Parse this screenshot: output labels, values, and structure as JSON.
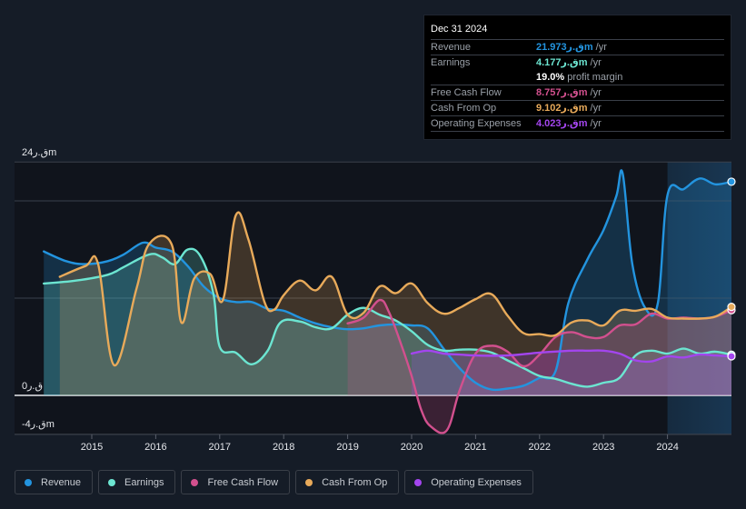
{
  "tooltip": {
    "date": "Dec 31 2024",
    "rows": [
      {
        "label": "Revenue",
        "value": "21.973ق.رm",
        "unit": "/yr",
        "color": "#2394df"
      },
      {
        "label": "Earnings",
        "value": "4.177ق.رm",
        "unit": "/yr",
        "color": "#6ce5d1"
      },
      {
        "label": "",
        "value": "19.0%",
        "unit": "profit margin",
        "color": "#ffffff"
      },
      {
        "label": "Free Cash Flow",
        "value": "8.757ق.رm",
        "unit": "/yr",
        "color": "#d2508e"
      },
      {
        "label": "Cash From Op",
        "value": "9.102ق.رm",
        "unit": "/yr",
        "color": "#e8aa5a"
      },
      {
        "label": "Operating Expenses",
        "value": "4.023ق.رm",
        "unit": "/yr",
        "color": "#a345ee"
      }
    ]
  },
  "legend": [
    {
      "label": "Revenue",
      "color": "#2394df"
    },
    {
      "label": "Earnings",
      "color": "#6ce5d1"
    },
    {
      "label": "Free Cash Flow",
      "color": "#d2508e"
    },
    {
      "label": "Cash From Op",
      "color": "#e8aa5a"
    },
    {
      "label": "Operating Expenses",
      "color": "#a345ee"
    }
  ],
  "chart_data": {
    "type": "area",
    "title": "",
    "xlabel": "",
    "ylabel": "",
    "y_unit": "ق.رm",
    "ylim": [
      -4,
      24
    ],
    "xlim": [
      2014.25,
      2025.0
    ],
    "y_tick_labels": [
      {
        "value": 24,
        "label": "24ق.رm"
      },
      {
        "value": 0,
        "label": "0ق.ر"
      },
      {
        "value": -4,
        "label": "-4ق.رm"
      }
    ],
    "gridlines": [
      24,
      20,
      10,
      0,
      -4
    ],
    "x_ticks": [
      "2015",
      "2016",
      "2017",
      "2018",
      "2019",
      "2020",
      "2021",
      "2022",
      "2023",
      "2024"
    ],
    "forecast_shade_from": 2024.0,
    "series": [
      {
        "name": "Revenue",
        "color": "#2394df",
        "points": [
          [
            2014.25,
            14.8
          ],
          [
            2014.6,
            13.8
          ],
          [
            2014.9,
            13.5
          ],
          [
            2015.25,
            13.8
          ],
          [
            2015.5,
            14.5
          ],
          [
            2015.8,
            15.7
          ],
          [
            2016.0,
            15.2
          ],
          [
            2016.25,
            14.8
          ],
          [
            2016.5,
            13.3
          ],
          [
            2016.75,
            11.2
          ],
          [
            2017.0,
            10.0
          ],
          [
            2017.25,
            9.6
          ],
          [
            2017.5,
            9.6
          ],
          [
            2017.75,
            8.9
          ],
          [
            2018.0,
            8.7
          ],
          [
            2018.25,
            8.0
          ],
          [
            2018.5,
            7.4
          ],
          [
            2018.75,
            7.0
          ],
          [
            2019.0,
            6.8
          ],
          [
            2019.25,
            6.9
          ],
          [
            2019.5,
            7.2
          ],
          [
            2019.75,
            7.3
          ],
          [
            2020.0,
            7.2
          ],
          [
            2020.25,
            6.9
          ],
          [
            2020.5,
            4.8
          ],
          [
            2020.75,
            2.8
          ],
          [
            2021.0,
            1.3
          ],
          [
            2021.25,
            0.6
          ],
          [
            2021.5,
            0.7
          ],
          [
            2021.75,
            1.0
          ],
          [
            2022.0,
            1.8
          ],
          [
            2022.25,
            2.5
          ],
          [
            2022.45,
            9.5
          ],
          [
            2022.75,
            14.0
          ],
          [
            2023.0,
            17.0
          ],
          [
            2023.2,
            20.5
          ],
          [
            2023.3,
            22.8
          ],
          [
            2023.45,
            13.5
          ],
          [
            2023.65,
            9.0
          ],
          [
            2023.85,
            9.5
          ],
          [
            2024.0,
            20.6
          ],
          [
            2024.25,
            21.2
          ],
          [
            2024.5,
            22.3
          ],
          [
            2024.75,
            21.7
          ],
          [
            2025.0,
            21.97
          ]
        ]
      },
      {
        "name": "Earnings",
        "color": "#6ce5d1",
        "points": [
          [
            2014.25,
            11.5
          ],
          [
            2014.75,
            11.8
          ],
          [
            2015.25,
            12.4
          ],
          [
            2015.5,
            13.2
          ],
          [
            2015.9,
            14.5
          ],
          [
            2016.1,
            14.2
          ],
          [
            2016.3,
            13.5
          ],
          [
            2016.5,
            15.0
          ],
          [
            2016.7,
            14.3
          ],
          [
            2016.9,
            10.5
          ],
          [
            2017.0,
            5.0
          ],
          [
            2017.25,
            4.4
          ],
          [
            2017.5,
            3.2
          ],
          [
            2017.75,
            4.6
          ],
          [
            2017.95,
            7.5
          ],
          [
            2018.25,
            7.6
          ],
          [
            2018.5,
            7.0
          ],
          [
            2018.75,
            6.9
          ],
          [
            2019.0,
            8.3
          ],
          [
            2019.25,
            9.0
          ],
          [
            2019.5,
            8.3
          ],
          [
            2019.75,
            7.7
          ],
          [
            2020.0,
            6.6
          ],
          [
            2020.25,
            5.2
          ],
          [
            2020.5,
            4.6
          ],
          [
            2020.75,
            4.7
          ],
          [
            2021.0,
            4.7
          ],
          [
            2021.25,
            4.4
          ],
          [
            2021.5,
            3.6
          ],
          [
            2021.75,
            2.8
          ],
          [
            2022.0,
            2.0
          ],
          [
            2022.25,
            1.7
          ],
          [
            2022.5,
            1.2
          ],
          [
            2022.75,
            0.9
          ],
          [
            2023.0,
            1.3
          ],
          [
            2023.25,
            1.8
          ],
          [
            2023.5,
            4.1
          ],
          [
            2023.75,
            4.6
          ],
          [
            2024.0,
            4.3
          ],
          [
            2024.25,
            4.8
          ],
          [
            2024.5,
            4.3
          ],
          [
            2024.75,
            4.5
          ],
          [
            2025.0,
            4.18
          ]
        ]
      },
      {
        "name": "Free Cash Flow",
        "color": "#d2508e",
        "points": [
          [
            2019.0,
            7.4
          ],
          [
            2019.25,
            8.0
          ],
          [
            2019.5,
            9.8
          ],
          [
            2019.65,
            8.5
          ],
          [
            2019.85,
            5.0
          ],
          [
            2020.0,
            2.0
          ],
          [
            2020.15,
            -1.5
          ],
          [
            2020.3,
            -3.2
          ],
          [
            2020.55,
            -3.6
          ],
          [
            2020.75,
            0.5
          ],
          [
            2021.0,
            4.3
          ],
          [
            2021.25,
            5.1
          ],
          [
            2021.5,
            4.5
          ],
          [
            2021.75,
            3.0
          ],
          [
            2022.0,
            4.2
          ],
          [
            2022.25,
            6.0
          ],
          [
            2022.5,
            6.5
          ],
          [
            2022.75,
            6.0
          ],
          [
            2023.0,
            6.0
          ],
          [
            2023.25,
            7.2
          ],
          [
            2023.5,
            7.3
          ],
          [
            2023.75,
            8.4
          ],
          [
            2024.0,
            7.9
          ],
          [
            2024.25,
            8.0
          ],
          [
            2024.5,
            7.9
          ],
          [
            2024.75,
            8.1
          ],
          [
            2025.0,
            8.76
          ]
        ]
      },
      {
        "name": "Cash From Op",
        "color": "#e8aa5a",
        "points": [
          [
            2014.5,
            12.2
          ],
          [
            2014.9,
            13.3
          ],
          [
            2015.1,
            13.5
          ],
          [
            2015.35,
            3.1
          ],
          [
            2015.7,
            11.0
          ],
          [
            2015.9,
            15.6
          ],
          [
            2016.25,
            15.5
          ],
          [
            2016.4,
            7.5
          ],
          [
            2016.6,
            12.0
          ],
          [
            2016.85,
            12.5
          ],
          [
            2017.05,
            9.8
          ],
          [
            2017.25,
            18.5
          ],
          [
            2017.45,
            16.0
          ],
          [
            2017.7,
            9.6
          ],
          [
            2017.85,
            8.8
          ],
          [
            2018.0,
            10.3
          ],
          [
            2018.25,
            11.8
          ],
          [
            2018.5,
            10.8
          ],
          [
            2018.75,
            12.2
          ],
          [
            2019.0,
            8.3
          ],
          [
            2019.25,
            8.5
          ],
          [
            2019.5,
            11.2
          ],
          [
            2019.75,
            10.5
          ],
          [
            2020.0,
            11.5
          ],
          [
            2020.25,
            9.5
          ],
          [
            2020.5,
            8.4
          ],
          [
            2020.75,
            9.0
          ],
          [
            2021.0,
            9.9
          ],
          [
            2021.25,
            10.4
          ],
          [
            2021.5,
            8.2
          ],
          [
            2021.75,
            6.4
          ],
          [
            2022.0,
            6.3
          ],
          [
            2022.25,
            6.2
          ],
          [
            2022.5,
            7.5
          ],
          [
            2022.75,
            7.7
          ],
          [
            2023.0,
            7.2
          ],
          [
            2023.25,
            8.7
          ],
          [
            2023.5,
            8.7
          ],
          [
            2023.75,
            8.9
          ],
          [
            2024.0,
            8.0
          ],
          [
            2024.25,
            7.9
          ],
          [
            2024.5,
            7.9
          ],
          [
            2024.75,
            8.1
          ],
          [
            2025.0,
            9.1
          ]
        ]
      },
      {
        "name": "Operating Expenses",
        "color": "#a345ee",
        "points": [
          [
            2020.0,
            4.3
          ],
          [
            2020.25,
            4.6
          ],
          [
            2020.5,
            4.3
          ],
          [
            2020.75,
            4.2
          ],
          [
            2021.0,
            4.1
          ],
          [
            2021.5,
            4.1
          ],
          [
            2022.0,
            4.4
          ],
          [
            2022.5,
            4.6
          ],
          [
            2022.75,
            4.6
          ],
          [
            2023.0,
            4.6
          ],
          [
            2023.25,
            4.3
          ],
          [
            2023.5,
            3.6
          ],
          [
            2023.75,
            3.5
          ],
          [
            2024.0,
            4.0
          ],
          [
            2024.25,
            3.9
          ],
          [
            2024.5,
            4.2
          ],
          [
            2024.75,
            4.1
          ],
          [
            2025.0,
            4.02
          ]
        ]
      }
    ]
  }
}
